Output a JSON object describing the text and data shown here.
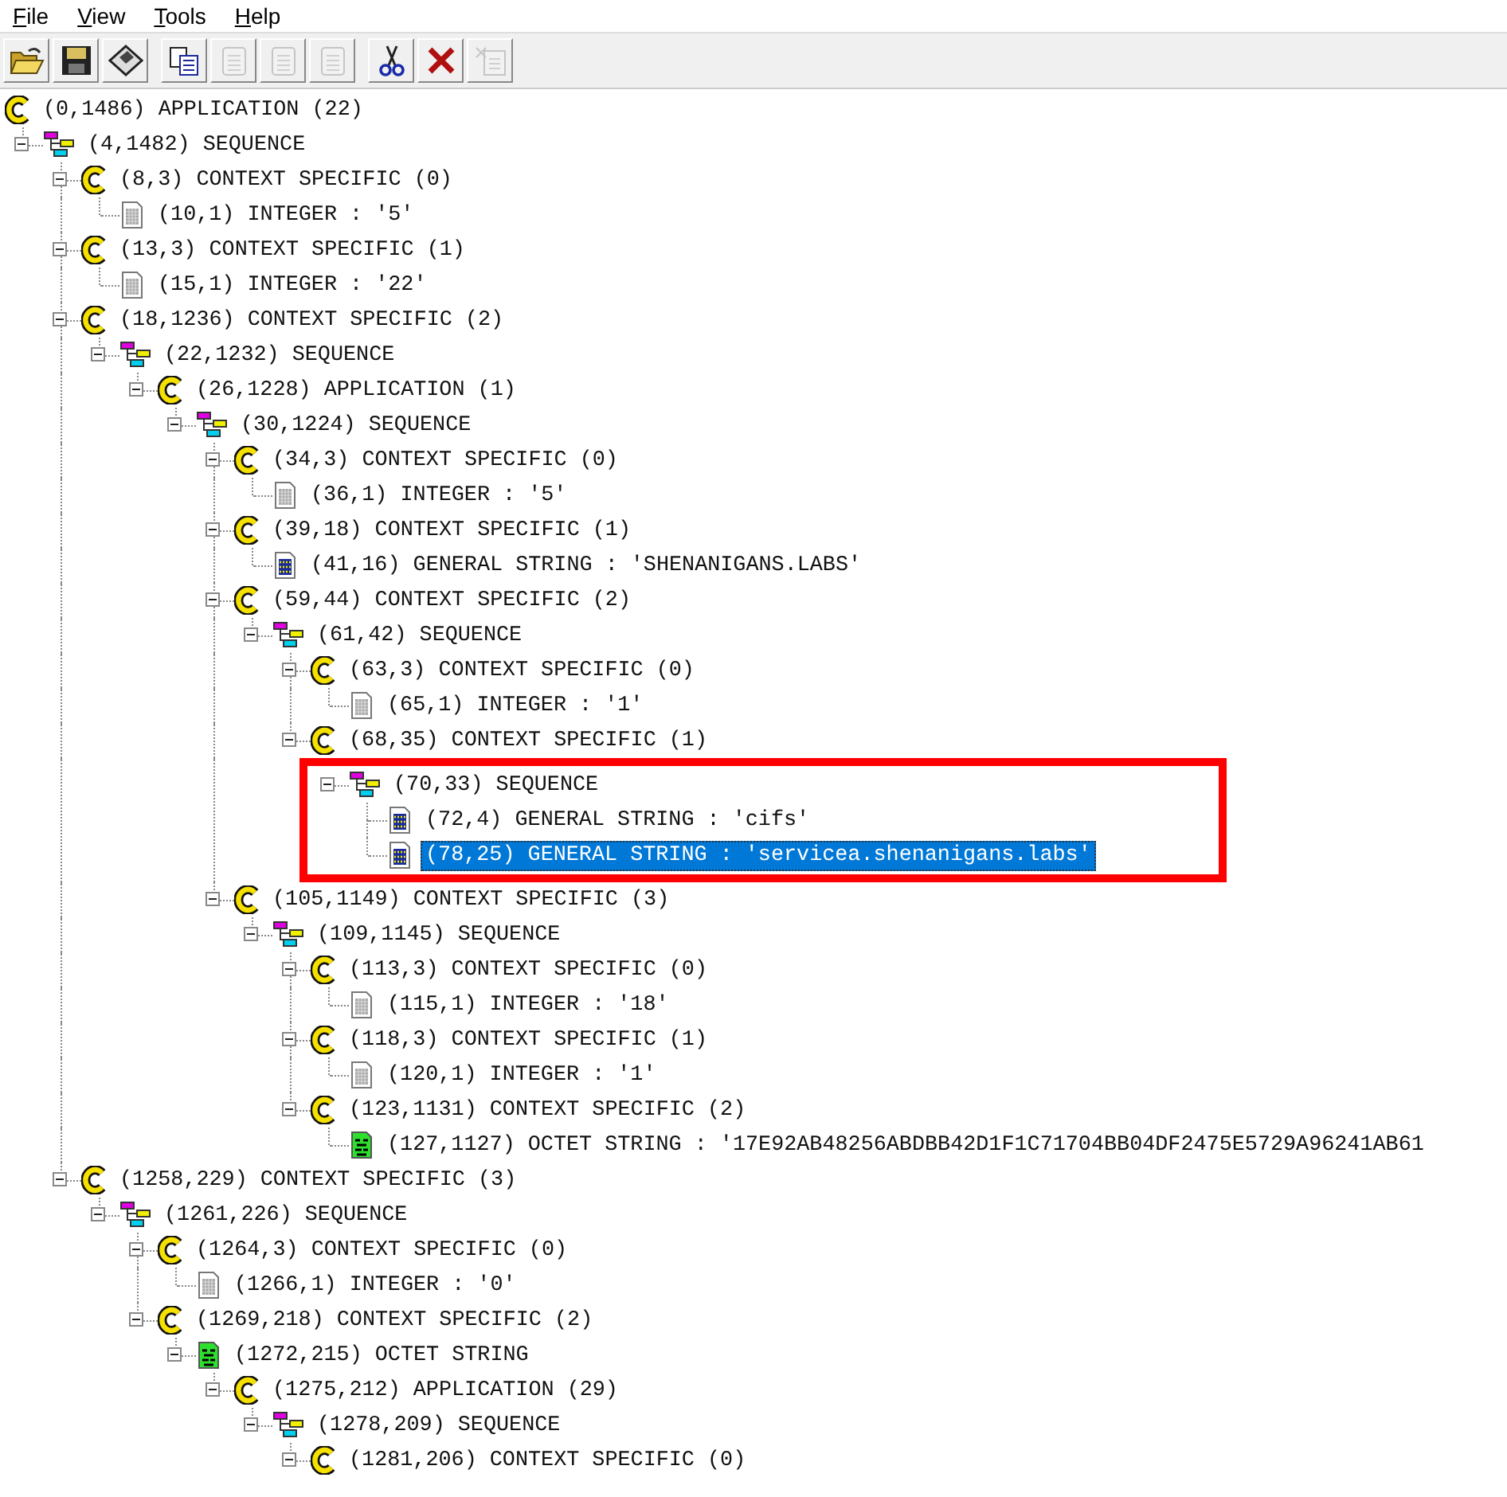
{
  "menu": [
    {
      "label": "File"
    },
    {
      "label": "View"
    },
    {
      "label": "Tools"
    },
    {
      "label": "Help"
    }
  ],
  "toolbar": [
    [
      {
        "kind": "open",
        "disabled": false
      },
      {
        "kind": "save",
        "disabled": false
      },
      {
        "kind": "disk",
        "disabled": false
      }
    ],
    [
      {
        "kind": "copy",
        "disabled": false
      },
      {
        "kind": "page",
        "disabled": true
      },
      {
        "kind": "page",
        "disabled": true
      },
      {
        "kind": "page",
        "disabled": true
      }
    ],
    [
      {
        "kind": "cut",
        "disabled": false
      },
      {
        "kind": "delete",
        "disabled": false
      },
      {
        "kind": "paste",
        "disabled": true
      }
    ]
  ],
  "tree": {
    "label": "(0,1486) APPLICATION (22)",
    "kind": "context",
    "selected": false,
    "children": [
      {
        "label": "(4,1482) SEQUENCE",
        "kind": "sequence",
        "selected": false,
        "expanded": true,
        "children": [
          {
            "label": "(8,3) CONTEXT SPECIFIC (0)",
            "kind": "context",
            "selected": false,
            "expanded": true,
            "children": [
              {
                "label": "(10,1) INTEGER : '5'",
                "kind": "integer",
                "selected": false
              }
            ]
          },
          {
            "label": "(13,3) CONTEXT SPECIFIC (1)",
            "kind": "context",
            "selected": false,
            "expanded": true,
            "children": [
              {
                "label": "(15,1) INTEGER : '22'",
                "kind": "integer",
                "selected": false
              }
            ]
          },
          {
            "label": "(18,1236) CONTEXT SPECIFIC (2)",
            "kind": "context",
            "selected": false,
            "expanded": true,
            "children": [
              {
                "label": "(22,1232) SEQUENCE",
                "kind": "sequence",
                "selected": false,
                "expanded": true,
                "children": [
                  {
                    "label": "(26,1228) APPLICATION (1)",
                    "kind": "context",
                    "selected": false,
                    "expanded": true,
                    "children": [
                      {
                        "label": "(30,1224) SEQUENCE",
                        "kind": "sequence",
                        "selected": false,
                        "expanded": true,
                        "children": [
                          {
                            "label": "(34,3) CONTEXT SPECIFIC (0)",
                            "kind": "context",
                            "selected": false,
                            "expanded": true,
                            "children": [
                              {
                                "label": "(36,1) INTEGER : '5'",
                                "kind": "integer",
                                "selected": false
                              }
                            ]
                          },
                          {
                            "label": "(39,18) CONTEXT SPECIFIC (1)",
                            "kind": "context",
                            "selected": false,
                            "expanded": true,
                            "children": [
                              {
                                "label": "(41,16) GENERAL STRING : 'SHENANIGANS.LABS'",
                                "kind": "string",
                                "selected": false
                              }
                            ]
                          },
                          {
                            "label": "(59,44) CONTEXT SPECIFIC (2)",
                            "kind": "context",
                            "selected": false,
                            "expanded": true,
                            "children": [
                              {
                                "label": "(61,42) SEQUENCE",
                                "kind": "sequence",
                                "selected": false,
                                "expanded": true,
                                "children": [
                                  {
                                    "label": "(63,3) CONTEXT SPECIFIC (0)",
                                    "kind": "context",
                                    "selected": false,
                                    "expanded": true,
                                    "children": [
                                      {
                                        "label": "(65,1) INTEGER : '1'",
                                        "kind": "integer",
                                        "selected": false
                                      }
                                    ]
                                  },
                                  {
                                    "label": "(68,35) CONTEXT SPECIFIC (1)",
                                    "kind": "context",
                                    "selected": false,
                                    "expanded": true,
                                    "children": [
                                      {
                                        "label": "(70,33) SEQUENCE",
                                        "kind": "sequence",
                                        "selected": false,
                                        "expanded": true,
                                        "boxed": true,
                                        "children": [
                                          {
                                            "label": "(72,4) GENERAL STRING : 'cifs'",
                                            "kind": "string",
                                            "selected": false
                                          },
                                          {
                                            "label": "(78,25) GENERAL STRING : 'servicea.shenanigans.labs'",
                                            "kind": "string",
                                            "selected": true
                                          }
                                        ]
                                      }
                                    ]
                                  }
                                ]
                              }
                            ]
                          },
                          {
                            "label": "(105,1149) CONTEXT SPECIFIC (3)",
                            "kind": "context",
                            "selected": false,
                            "expanded": true,
                            "children": [
                              {
                                "label": "(109,1145) SEQUENCE",
                                "kind": "sequence",
                                "selected": false,
                                "expanded": true,
                                "children": [
                                  {
                                    "label": "(113,3) CONTEXT SPECIFIC (0)",
                                    "kind": "context",
                                    "selected": false,
                                    "expanded": true,
                                    "children": [
                                      {
                                        "label": "(115,1) INTEGER : '18'",
                                        "kind": "integer",
                                        "selected": false
                                      }
                                    ]
                                  },
                                  {
                                    "label": "(118,3) CONTEXT SPECIFIC (1)",
                                    "kind": "context",
                                    "selected": false,
                                    "expanded": true,
                                    "children": [
                                      {
                                        "label": "(120,1) INTEGER : '1'",
                                        "kind": "integer",
                                        "selected": false
                                      }
                                    ]
                                  },
                                  {
                                    "label": "(123,1131) CONTEXT SPECIFIC (2)",
                                    "kind": "context",
                                    "selected": false,
                                    "expanded": true,
                                    "children": [
                                      {
                                        "label": "(127,1127) OCTET STRING : '17E92AB48256ABDBB42D1F1C71704BB04DF2475E5729A96241AB61",
                                        "kind": "octet",
                                        "selected": false
                                      }
                                    ]
                                  }
                                ]
                              }
                            ]
                          }
                        ]
                      }
                    ]
                  }
                ]
              }
            ]
          },
          {
            "label": "(1258,229) CONTEXT SPECIFIC (3)",
            "kind": "context",
            "selected": false,
            "expanded": true,
            "children": [
              {
                "label": "(1261,226) SEQUENCE",
                "kind": "sequence",
                "selected": false,
                "expanded": true,
                "children": [
                  {
                    "label": "(1264,3) CONTEXT SPECIFIC (0)",
                    "kind": "context",
                    "selected": false,
                    "expanded": true,
                    "children": [
                      {
                        "label": "(1266,1) INTEGER : '0'",
                        "kind": "integer",
                        "selected": false
                      }
                    ]
                  },
                  {
                    "label": "(1269,218) CONTEXT SPECIFIC (2)",
                    "kind": "context",
                    "selected": false,
                    "expanded": true,
                    "children": [
                      {
                        "label": "(1272,215) OCTET STRING",
                        "kind": "octet",
                        "selected": false,
                        "expanded": true,
                        "children": [
                          {
                            "label": "(1275,212) APPLICATION (29)",
                            "kind": "context",
                            "selected": false,
                            "expanded": true,
                            "children": [
                              {
                                "label": "(1278,209) SEQUENCE",
                                "kind": "sequence",
                                "selected": false,
                                "expanded": true,
                                "children": [
                                  {
                                    "label": "(1281,206) CONTEXT SPECIFIC (0)",
                                    "kind": "context",
                                    "selected": false,
                                    "expanded": true
                                  }
                                ]
                              }
                            ]
                          }
                        ]
                      }
                    ]
                  }
                ]
              }
            ]
          }
        ]
      }
    ]
  }
}
